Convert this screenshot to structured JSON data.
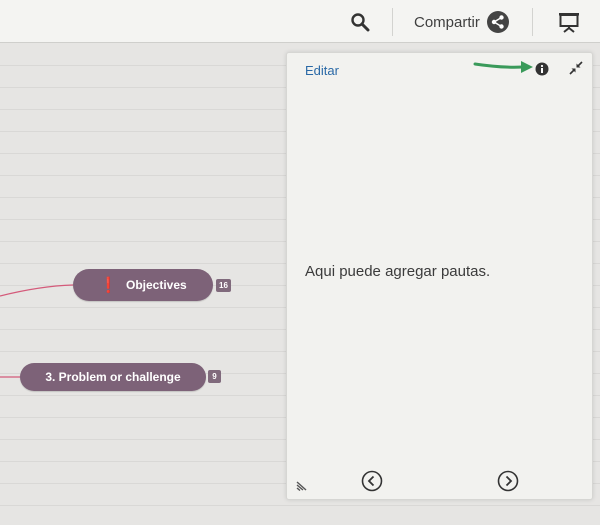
{
  "toolbar": {
    "search_icon": "search-icon",
    "share_label": "Compartir",
    "share_icon": "share-icon",
    "present_icon": "presentation-icon"
  },
  "map": {
    "nodes": [
      {
        "label": "Objectives",
        "icon": "exclamation-icon",
        "badge": "16"
      },
      {
        "label": "3. Problem or challenge",
        "badge": "9"
      }
    ],
    "colors": {
      "node": "#7d6278",
      "link": "#d45a7a",
      "exclamation": "#d2232a"
    }
  },
  "notes_panel": {
    "edit_label": "Editar",
    "info_icon": "info-icon",
    "collapse_icon": "collapse-icon",
    "annotation_arrow": "green-arrow",
    "body_text": "Aqui puede agregar pautas.",
    "prev_icon": "chevron-left-circle-icon",
    "next_icon": "chevron-right-circle-icon",
    "resize_icon": "resize-handle-icon",
    "colors": {
      "link": "#2a69a6",
      "arrow": "#3a9a5a"
    }
  }
}
